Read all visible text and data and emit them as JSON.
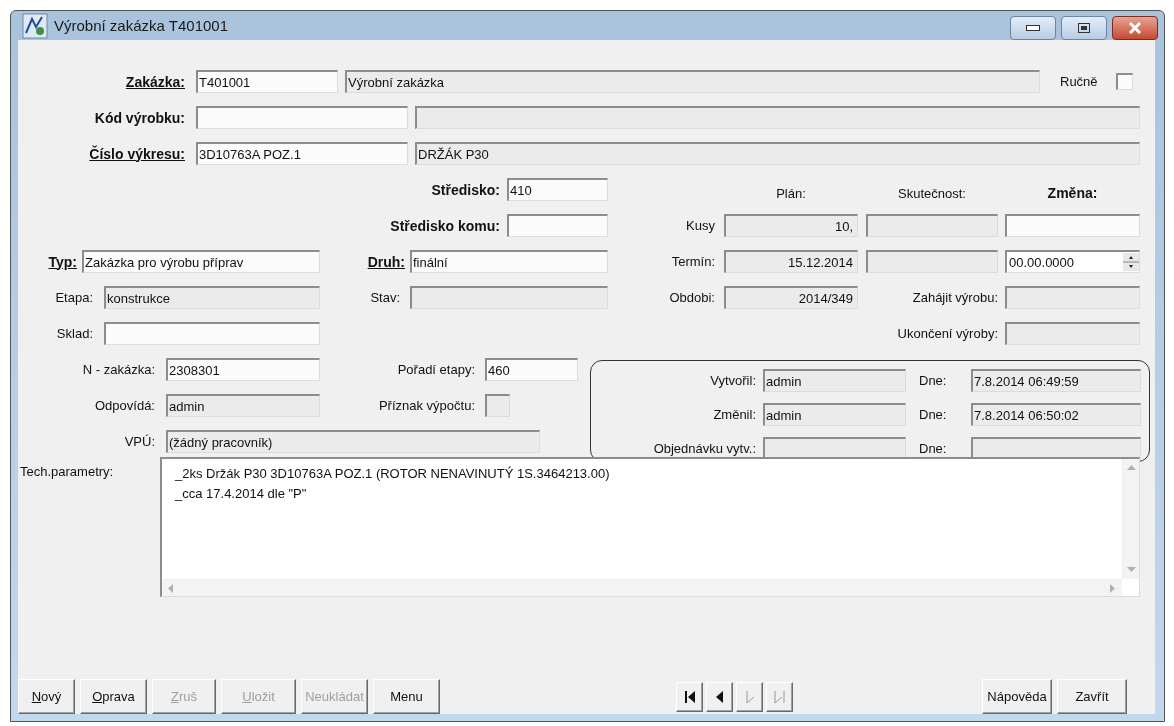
{
  "window": {
    "title": "Výrobní zakázka T401001"
  },
  "header": {
    "zakazka": {
      "label": "Zakázka:",
      "bold": true,
      "underlined": true,
      "code": {
        "value": "T401001",
        "readonly": false
      },
      "name": {
        "value": "Výrobní zakázka",
        "readonly": true
      }
    },
    "rucne": {
      "label": "Ručně",
      "checked": false
    },
    "kod_vyrobku": {
      "label": "Kód výrobku:",
      "bold": true,
      "underlined": false,
      "code": {
        "readonly": false
      },
      "name": {
        "readonly": true
      }
    },
    "cislo_vykresu": {
      "label": "Číslo výkresu:",
      "bold": true,
      "underlined": true,
      "code": {
        "value": "3D10763A POZ.1",
        "readonly": false
      },
      "name": {
        "value": "DRŽÁK P30",
        "readonly": true
      }
    }
  },
  "details": {
    "stredisko": {
      "label": "Středisko:",
      "bold": true,
      "underlined": false,
      "value": "410",
      "readonly": false
    },
    "stredisko_komu": {
      "label": "Středisko komu:",
      "bold": true,
      "underlined": false,
      "readonly": false
    },
    "typ": {
      "label": "Typ:",
      "bold": true,
      "underlined": true,
      "value": "Zakázka pro výrobu příprav",
      "readonly": false
    },
    "druh": {
      "label": "Druh:",
      "bold": true,
      "underlined": true,
      "value": "finální",
      "readonly": false
    },
    "etapa": {
      "label": "Etapa:",
      "bold": false,
      "underlined": false,
      "value": "konstrukce",
      "readonly": true
    },
    "stav": {
      "label": "Stav:",
      "bold": false,
      "underlined": false,
      "readonly": true
    },
    "sklad": {
      "label": "Sklad:",
      "bold": false,
      "underlined": false,
      "readonly": false
    },
    "n_zakazka": {
      "label": "N - zakázka:",
      "bold": false,
      "underlined": false,
      "value": "2308301",
      "readonly": false
    },
    "poradi_etapy": {
      "label": "Pořadí etapy:",
      "bold": false,
      "underlined": false,
      "value": "460",
      "readonly": false
    },
    "odpovida": {
      "label": "Odpovídá:",
      "bold": false,
      "underlined": false,
      "value": "admin",
      "readonly": true
    },
    "priznak_vypoctu": {
      "label": "Příznak výpočtu:",
      "bold": false,
      "underlined": false,
      "readonly": true
    },
    "vpu": {
      "label": "VPÚ:",
      "bold": false,
      "underlined": false,
      "value": "(žádný pracovník)",
      "readonly": true
    }
  },
  "quantities": {
    "columns": [
      {
        "label": "Plán:",
        "bold": false
      },
      {
        "label": "Skutečnost:",
        "bold": false
      },
      {
        "label": "Změna:",
        "bold": true
      }
    ],
    "rows": [
      {
        "label": "Kusy",
        "cells": [
          {
            "kind": "text",
            "value": "10,",
            "readonly": true
          },
          {
            "kind": "text",
            "readonly": true
          },
          {
            "kind": "text",
            "readonly": false
          }
        ]
      },
      {
        "label": "Termín:",
        "cells": [
          {
            "kind": "text",
            "value": "15.12.2014",
            "readonly": true
          },
          {
            "kind": "text",
            "readonly": true
          },
          {
            "kind": "spinner",
            "value": "00.00.0000",
            "readonly": false
          }
        ]
      }
    ],
    "obdobi": {
      "label": "Obdobi:",
      "value": "2014/349",
      "readonly": true
    },
    "zahajit_vyrobu": {
      "label": "Zahájit výrobu:",
      "readonly": true
    },
    "ukonceni_vyroby": {
      "label": "Ukončení výroby:",
      "readonly": true
    }
  },
  "audit": [
    {
      "label": "Vytvořil:",
      "value": "admin",
      "date_label": "Dne:",
      "date": "7.8.2014 06:49:59"
    },
    {
      "label": "Změnil:",
      "value": "admin",
      "date_label": "Dne:",
      "date": "7.8.2014 06:50:02"
    },
    {
      "label": "Objednávku vytv.:",
      "date_label": "Dne:"
    }
  ],
  "tech_parametry": {
    "label": "Tech.parametry:",
    "lines": [
      "_2ks Držák P30 3D10763A POZ.1 (ROTOR NENAVINUTÝ 1S.3464213.00)",
      "_cca 17.4.2014 dle \"P\""
    ]
  },
  "buttons": [
    {
      "label": "Nový",
      "accesskey": true,
      "disabled": false
    },
    {
      "label": "Oprava",
      "accesskey": true,
      "disabled": false
    },
    {
      "label": "Zruš",
      "accesskey": true,
      "disabled": true
    },
    {
      "label": "Uložit",
      "accesskey": true,
      "disabled": true
    },
    {
      "label": "Neukládat",
      "accesskey": false,
      "disabled": true
    },
    {
      "label": "Menu",
      "accesskey": false,
      "disabled": false
    }
  ],
  "navigation": [
    {
      "kind": "first",
      "disabled": false
    },
    {
      "kind": "prev",
      "disabled": false
    },
    {
      "kind": "next",
      "disabled": true
    },
    {
      "kind": "last",
      "disabled": true
    }
  ],
  "right_buttons": [
    {
      "label": "Nápověda",
      "disabled": false
    },
    {
      "label": "Zavřít",
      "disabled": false
    }
  ]
}
